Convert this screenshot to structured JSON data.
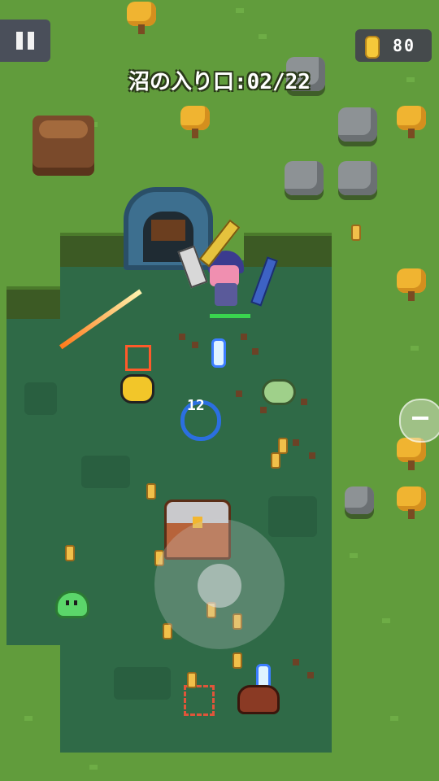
{
  "hud": {
    "stage_title": "沼の入り口:02/22",
    "coin_count": "80",
    "pause_icon": "pause-icon",
    "coin_icon": "gold-coin-icon",
    "side_button_icon": "minus-icon"
  },
  "floating_text": {
    "damage_number": "12"
  },
  "colors": {
    "grass": "#619c3c",
    "swamp": "#2f6a47",
    "coin": "#f6c93a",
    "hud_panel": "#454a4c"
  }
}
